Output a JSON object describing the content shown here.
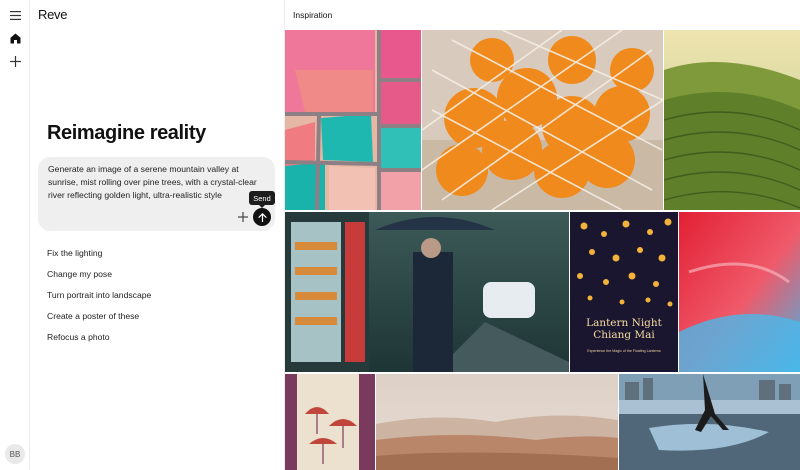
{
  "app": {
    "logo": "Reve"
  },
  "rail": {
    "avatar_initials": "BB"
  },
  "main": {
    "headline": "Reimagine reality",
    "prompt": {
      "text": "Generate an image of a serene mountain valley at sunrise, mist rolling over pine trees, with a crystal-clear river reflecting golden light, ultra-realistic style",
      "send_tooltip": "Send"
    },
    "suggestions": [
      {
        "label": "Fix the lighting"
      },
      {
        "label": "Change my pose"
      },
      {
        "label": "Turn portrait into landscape"
      },
      {
        "label": "Create a poster of these"
      },
      {
        "label": "Refocus a photo"
      }
    ]
  },
  "inspiration": {
    "title": "Inspiration",
    "poster": {
      "title_line1": "Lantern Night",
      "title_line2": "Chiang Mai",
      "tagline": "Experience the Magic of the Floating Lanterns"
    }
  },
  "icons": [
    "menu-icon",
    "home-icon",
    "plus-icon",
    "arrow-up-icon"
  ],
  "colors": {
    "accent": "#111111",
    "prompt_bg": "#efefef",
    "border": "#ececec"
  }
}
